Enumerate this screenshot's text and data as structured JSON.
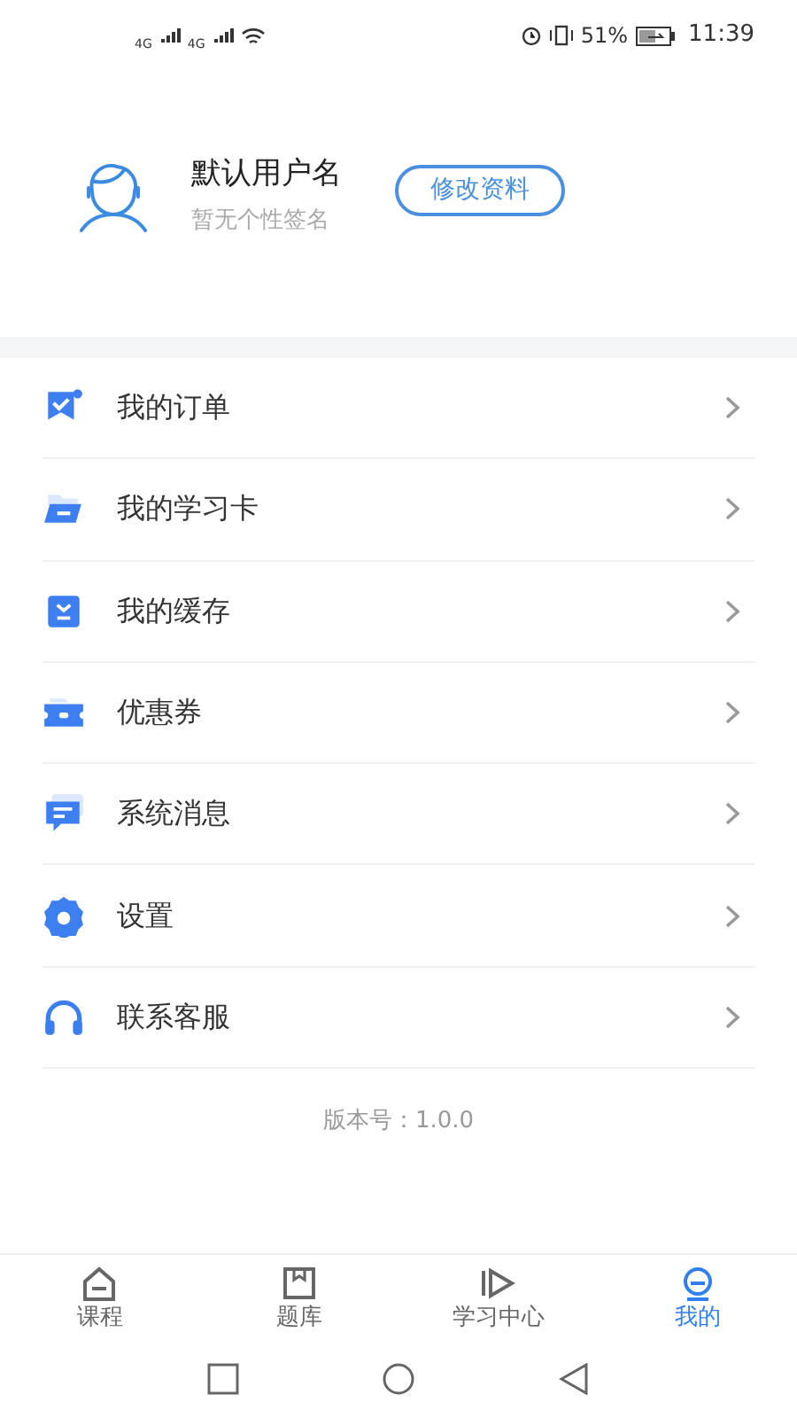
{
  "status_bar": {
    "network_1": "4G",
    "network_2": "4G",
    "battery": "51%",
    "time": "11:39"
  },
  "profile": {
    "username": "默认用户名",
    "signature": "暂无个性签名",
    "edit_button": "修改资料"
  },
  "menu": [
    {
      "label": "我的订单"
    },
    {
      "label": "我的学习卡"
    },
    {
      "label": "我的缓存"
    },
    {
      "label": "优惠券"
    },
    {
      "label": "系统消息"
    },
    {
      "label": "设置"
    },
    {
      "label": "联系客服"
    }
  ],
  "version": "版本号：1.0.0",
  "tabs": [
    {
      "label": "课程",
      "selected": false
    },
    {
      "label": "题库",
      "selected": false
    },
    {
      "label": "学习中心",
      "selected": false
    },
    {
      "label": "我的",
      "selected": true
    }
  ]
}
